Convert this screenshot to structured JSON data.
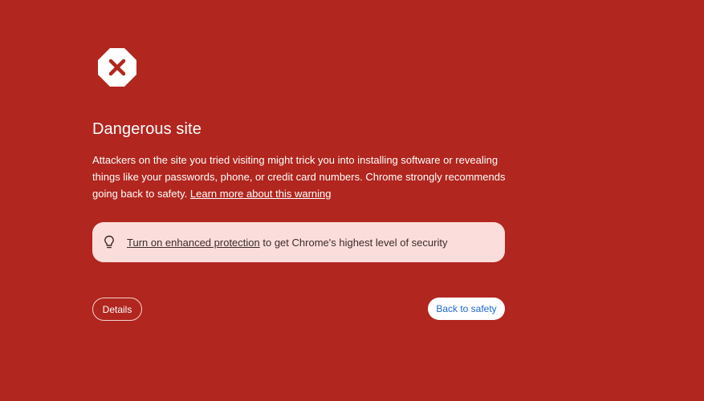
{
  "interstitial": {
    "icon": "danger-octagon-x-icon",
    "title": "Dangerous site",
    "body_text": "Attackers on the site you tried visiting might trick you into installing software or revealing things like your passwords, phone, or credit card numbers. Chrome strongly recommends going back to safety.",
    "learn_more_link": "Learn more about this warning",
    "tip": {
      "icon": "lightbulb-icon",
      "link_text": "Turn on enhanced protection",
      "text": "to get Chrome's highest level of security"
    },
    "details_button": "Details",
    "back_button": "Back to safety"
  },
  "colors": {
    "background": "#b1261e",
    "tip_background": "#fbdedb",
    "primary_button_text": "#1a66d2"
  }
}
